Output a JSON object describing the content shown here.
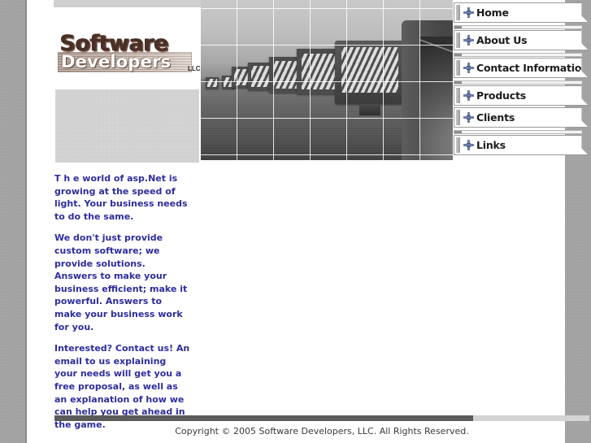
{
  "site": {
    "logo": {
      "line1": "Software",
      "line2": "Developers",
      "suffix": "LLC"
    }
  },
  "hero": {
    "alt": "Row of monitors in a desert landscape with cursor arrow",
    "icon": "monitors-photo"
  },
  "nav": {
    "items": [
      {
        "label": "Home"
      },
      {
        "label": "About Us"
      },
      {
        "label": "Contact Information"
      },
      {
        "label": "Products"
      },
      {
        "label": "Clients"
      },
      {
        "label": "Links"
      }
    ]
  },
  "main": {
    "paragraphs": [
      "T h e world  of  asp.Net  is growing at the speed of light.  Your business needs to do the same.",
      "We don't just provide custom software; we provide solutions.  Answers to make your business efficient; make it powerful.  Answers to make your business work for you.",
      "Interested?  Contact us!  An email to us explaining your needs will get you a free proposal, as well as an explanation of how we can help you get ahead in the game."
    ]
  },
  "footer": {
    "copyright": "Copyright © 2005 Software Developers, LLC. All Rights Reserved."
  },
  "colors": {
    "page_background": "#a2a2a2",
    "content_background": "#ffffff",
    "body_text": "#2d2d9e",
    "logo_primary": "#4a2f26",
    "rule_dark": "#5b5b5b",
    "rule_light": "#d4d4d4"
  }
}
